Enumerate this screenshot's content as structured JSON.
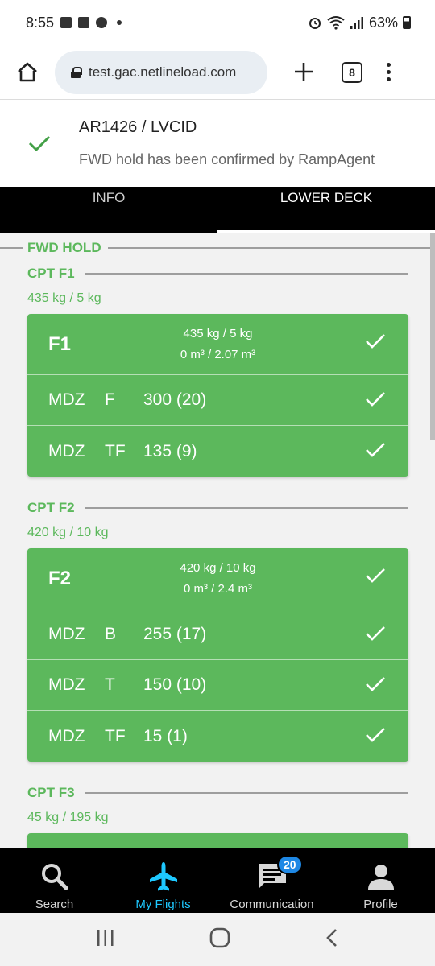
{
  "status": {
    "time": "8:55",
    "battery": "63%"
  },
  "browser": {
    "url": "test.gac.netlineload.com",
    "tab_count": "8"
  },
  "notice": {
    "title": "AR1426 / LVCID",
    "message": "FWD hold has been confirmed by RampAgent"
  },
  "tabs": [
    {
      "label": "INFO"
    },
    {
      "label": "LOWER DECK"
    }
  ],
  "hold": {
    "title": "FWD HOLD",
    "compartments": [
      {
        "title": "CPT F1",
        "weight": "435 kg / 5 kg",
        "card": {
          "id": "F1",
          "weight": "435 kg / 5 kg",
          "volume": "0 m³ / 2.07 m³",
          "rows": [
            {
              "dest": "MDZ",
              "cls": "F",
              "value": "300 (20)"
            },
            {
              "dest": "MDZ",
              "cls": "TF",
              "value": "135 (9)"
            }
          ]
        }
      },
      {
        "title": "CPT F2",
        "weight": "420 kg / 10 kg",
        "card": {
          "id": "F2",
          "weight": "420 kg / 10 kg",
          "volume": "0 m³ / 2.4 m³",
          "rows": [
            {
              "dest": "MDZ",
              "cls": "B",
              "value": "255 (17)"
            },
            {
              "dest": "MDZ",
              "cls": "T",
              "value": "150 (10)"
            },
            {
              "dest": "MDZ",
              "cls": "TF",
              "value": "15 (1)"
            }
          ]
        }
      },
      {
        "title": "CPT F3",
        "weight": "45 kg / 195 kg"
      }
    ]
  },
  "nav": [
    {
      "label": "Search",
      "icon": "search-icon"
    },
    {
      "label": "My Flights",
      "icon": "airplane-icon"
    },
    {
      "label": "Communication",
      "icon": "chat-icon",
      "badge": "20"
    },
    {
      "label": "Profile",
      "icon": "person-icon"
    }
  ],
  "colors": {
    "accent": "#5cb85c",
    "nav_active": "#1ec8ff",
    "badge": "#1e88e5"
  }
}
